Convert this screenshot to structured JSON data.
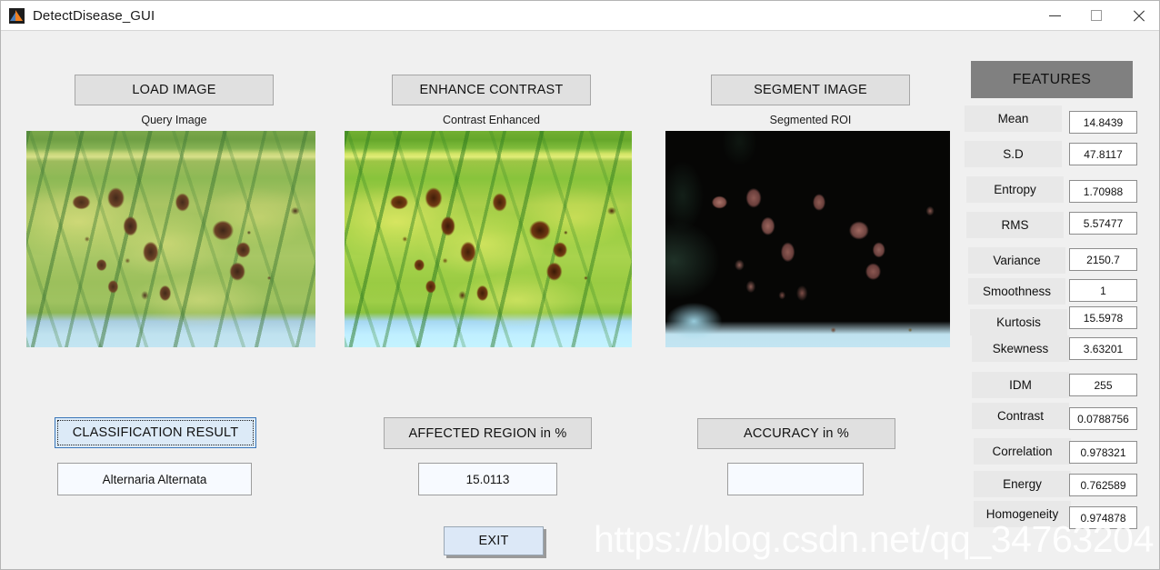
{
  "window": {
    "title": "DetectDisease_GUI",
    "icon": "matlab-icon",
    "controls": {
      "minimize": "minimize-icon",
      "maximize": "maximize-icon",
      "close": "close-icon"
    }
  },
  "panels": [
    {
      "button": "LOAD IMAGE",
      "caption": "Query Image",
      "image": "leaf-with-brown-lesions"
    },
    {
      "button": "ENHANCE CONTRAST",
      "caption": "Contrast Enhanced",
      "image": "leaf-contrast-enhanced"
    },
    {
      "button": "SEGMENT IMAGE",
      "caption": "Segmented ROI",
      "image": "segmented-roi-black-background"
    }
  ],
  "results": {
    "classification": {
      "button": "CLASSIFICATION RESULT",
      "value": "Alternaria Alternata"
    },
    "affected_region": {
      "button": "AFFECTED REGION in %",
      "value": "15.0113"
    },
    "accuracy": {
      "button": "ACCURACY in %",
      "value": ""
    },
    "exit": "EXIT"
  },
  "features": {
    "header": "FEATURES",
    "rows": [
      {
        "label": "Mean",
        "value": "14.8439"
      },
      {
        "label": "S.D",
        "value": "47.8117"
      },
      {
        "label": "Entropy",
        "value": "1.70988"
      },
      {
        "label": "RMS",
        "value": "5.57477"
      },
      {
        "label": "Variance",
        "value": "2150.7"
      },
      {
        "label": "Smoothness",
        "value": "1"
      },
      {
        "label": "Kurtosis",
        "value": "15.5978"
      },
      {
        "label": "Skewness",
        "value": "3.63201"
      },
      {
        "label": "IDM",
        "value": "255"
      },
      {
        "label": "Contrast",
        "value": "0.0788756"
      },
      {
        "label": "Correlation",
        "value": "0.978321"
      },
      {
        "label": "Energy",
        "value": "0.762589"
      },
      {
        "label": "Homogeneity",
        "value": "0.974878"
      }
    ]
  },
  "watermark": "https://blog.csdn.net/qq_34763204",
  "colors": {
    "window_background": "#f0f0f0",
    "titlebar": "#ffffff",
    "button_face": "#e0e0e0",
    "features_header": "#808080",
    "feature_label": "#e8e8e8",
    "focus_blue": "#3a76b8",
    "focus_fill": "#dceaf7",
    "exit_fill": "#dce8f7"
  }
}
